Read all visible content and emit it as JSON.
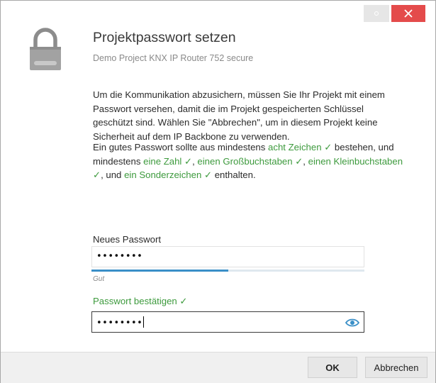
{
  "window": {
    "minimize_icon": "circle-icon",
    "close_glyph": "✕"
  },
  "header": {
    "icon": "padlock-icon",
    "title": "Projektpasswort setzen",
    "subtitle": "Demo Project KNX IP Router 752 secure"
  },
  "intro": {
    "text": "Um die Kommunikation abzusichern, müssen Sie Ihr Projekt mit einem Passwort versehen, damit die im Projekt gespeicherten Schlüssel geschützt sind. Wählen Sie \"Abbrechen\", um in diesem Projekt keine Sicherheit auf dem IP Backbone zu verwenden."
  },
  "requirements": {
    "t1": "Ein gutes Passwort sollte aus mindestens ",
    "r1": "acht Zeichen ✓",
    "t2": " bestehen, und mindestens ",
    "r2": "eine Zahl ✓",
    "t3": ", ",
    "r3": "einen Großbuchstaben ✓",
    "t4": ", ",
    "r4": "einen Kleinbuchstaben ✓",
    "t5": ", und ",
    "r5": "ein Sonderzeichen ✓",
    "t6": " enthalten.",
    "ok_color": "#3d9a3d"
  },
  "new_password": {
    "label": "Neues Passwort",
    "value": "••••••••",
    "strength_label": "Gut",
    "strength_fraction": 0.5,
    "strength_color": "#3a8fc7"
  },
  "confirm_password": {
    "label": "Passwort bestätigen ✓",
    "value": "••••••••",
    "reveal_icon": "eye-icon"
  },
  "buttons": {
    "ok": "OK",
    "cancel": "Abbrechen"
  },
  "colors": {
    "close_button": "#e44b4b",
    "accent": "#3a8fc7"
  }
}
